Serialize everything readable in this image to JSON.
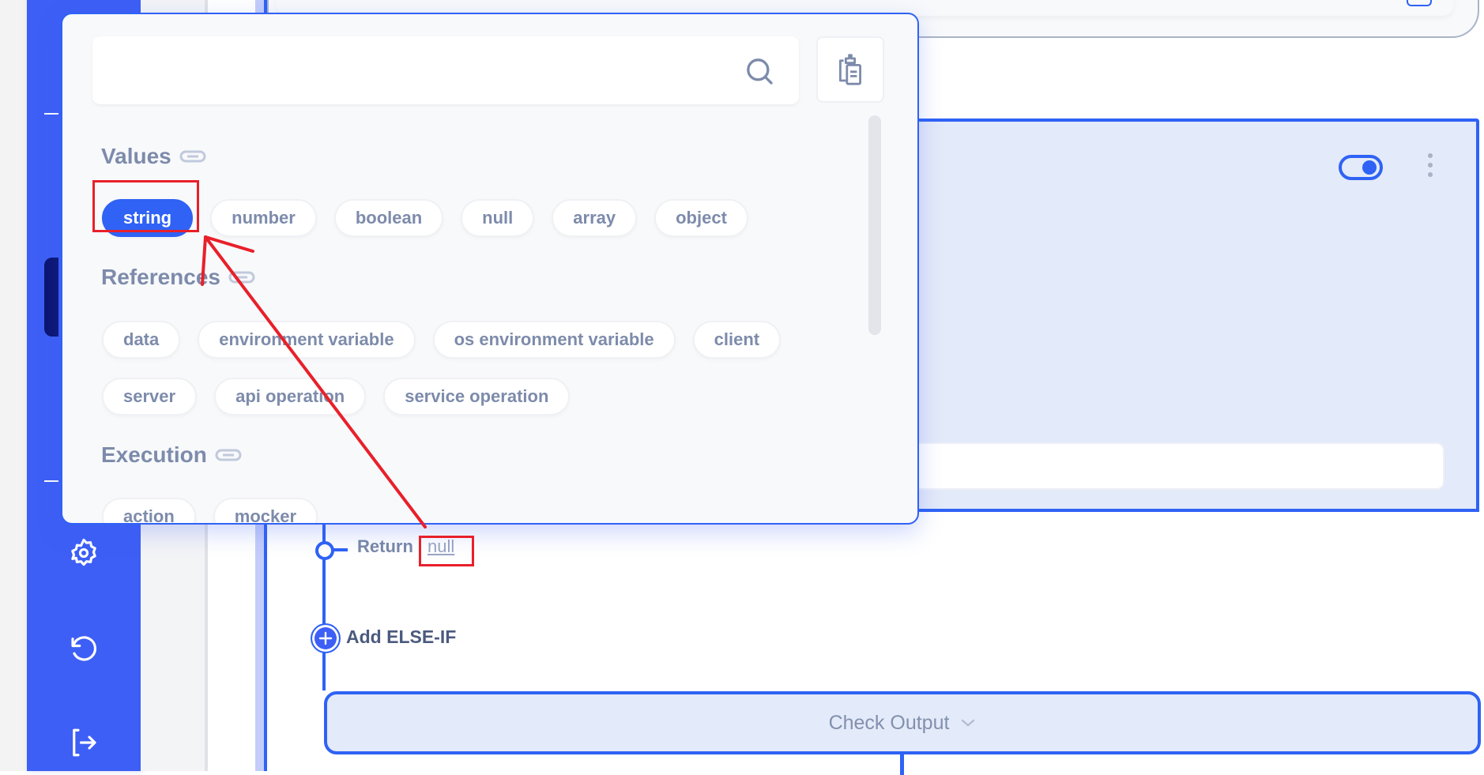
{
  "sidebar": {
    "items": [
      {
        "icon": "settings-gear-icon",
        "label": "Settings"
      },
      {
        "icon": "history-undo-icon",
        "label": "Revert"
      },
      {
        "icon": "logout-icon",
        "label": "Logout"
      }
    ]
  },
  "popup": {
    "search": {
      "value": "",
      "placeholder": ""
    },
    "search_icon": "search-icon",
    "paste_icon": "clipboard-icon",
    "sections": [
      {
        "title": "Values",
        "icon": "link-icon",
        "chips": [
          {
            "label": "string",
            "selected": true
          },
          {
            "label": "number",
            "selected": false
          },
          {
            "label": "boolean",
            "selected": false
          },
          {
            "label": "null",
            "selected": false
          },
          {
            "label": "array",
            "selected": false
          },
          {
            "label": "object",
            "selected": false
          }
        ]
      },
      {
        "title": "References",
        "icon": "link-icon",
        "chips_rows": [
          [
            "data",
            "environment variable",
            "os environment variable",
            "client"
          ],
          [
            "server",
            "api operation",
            "service operation"
          ]
        ]
      },
      {
        "title": "Execution",
        "icon": "link-icon",
        "chips": [
          {
            "label": "action"
          },
          {
            "label": "mocker"
          }
        ]
      }
    ]
  },
  "condition_card": {
    "toggle_on": true,
    "input_value": ""
  },
  "flow": {
    "return_label": "Return",
    "return_value": "null",
    "add_elseif_label": "Add ELSE-IF",
    "check_output_label": "Check Output"
  },
  "colors": {
    "accent": "#2f62f5",
    "sidebar": "#3d5ff5",
    "annotation": "#e8202a",
    "chip_text": "#7d8bab"
  }
}
